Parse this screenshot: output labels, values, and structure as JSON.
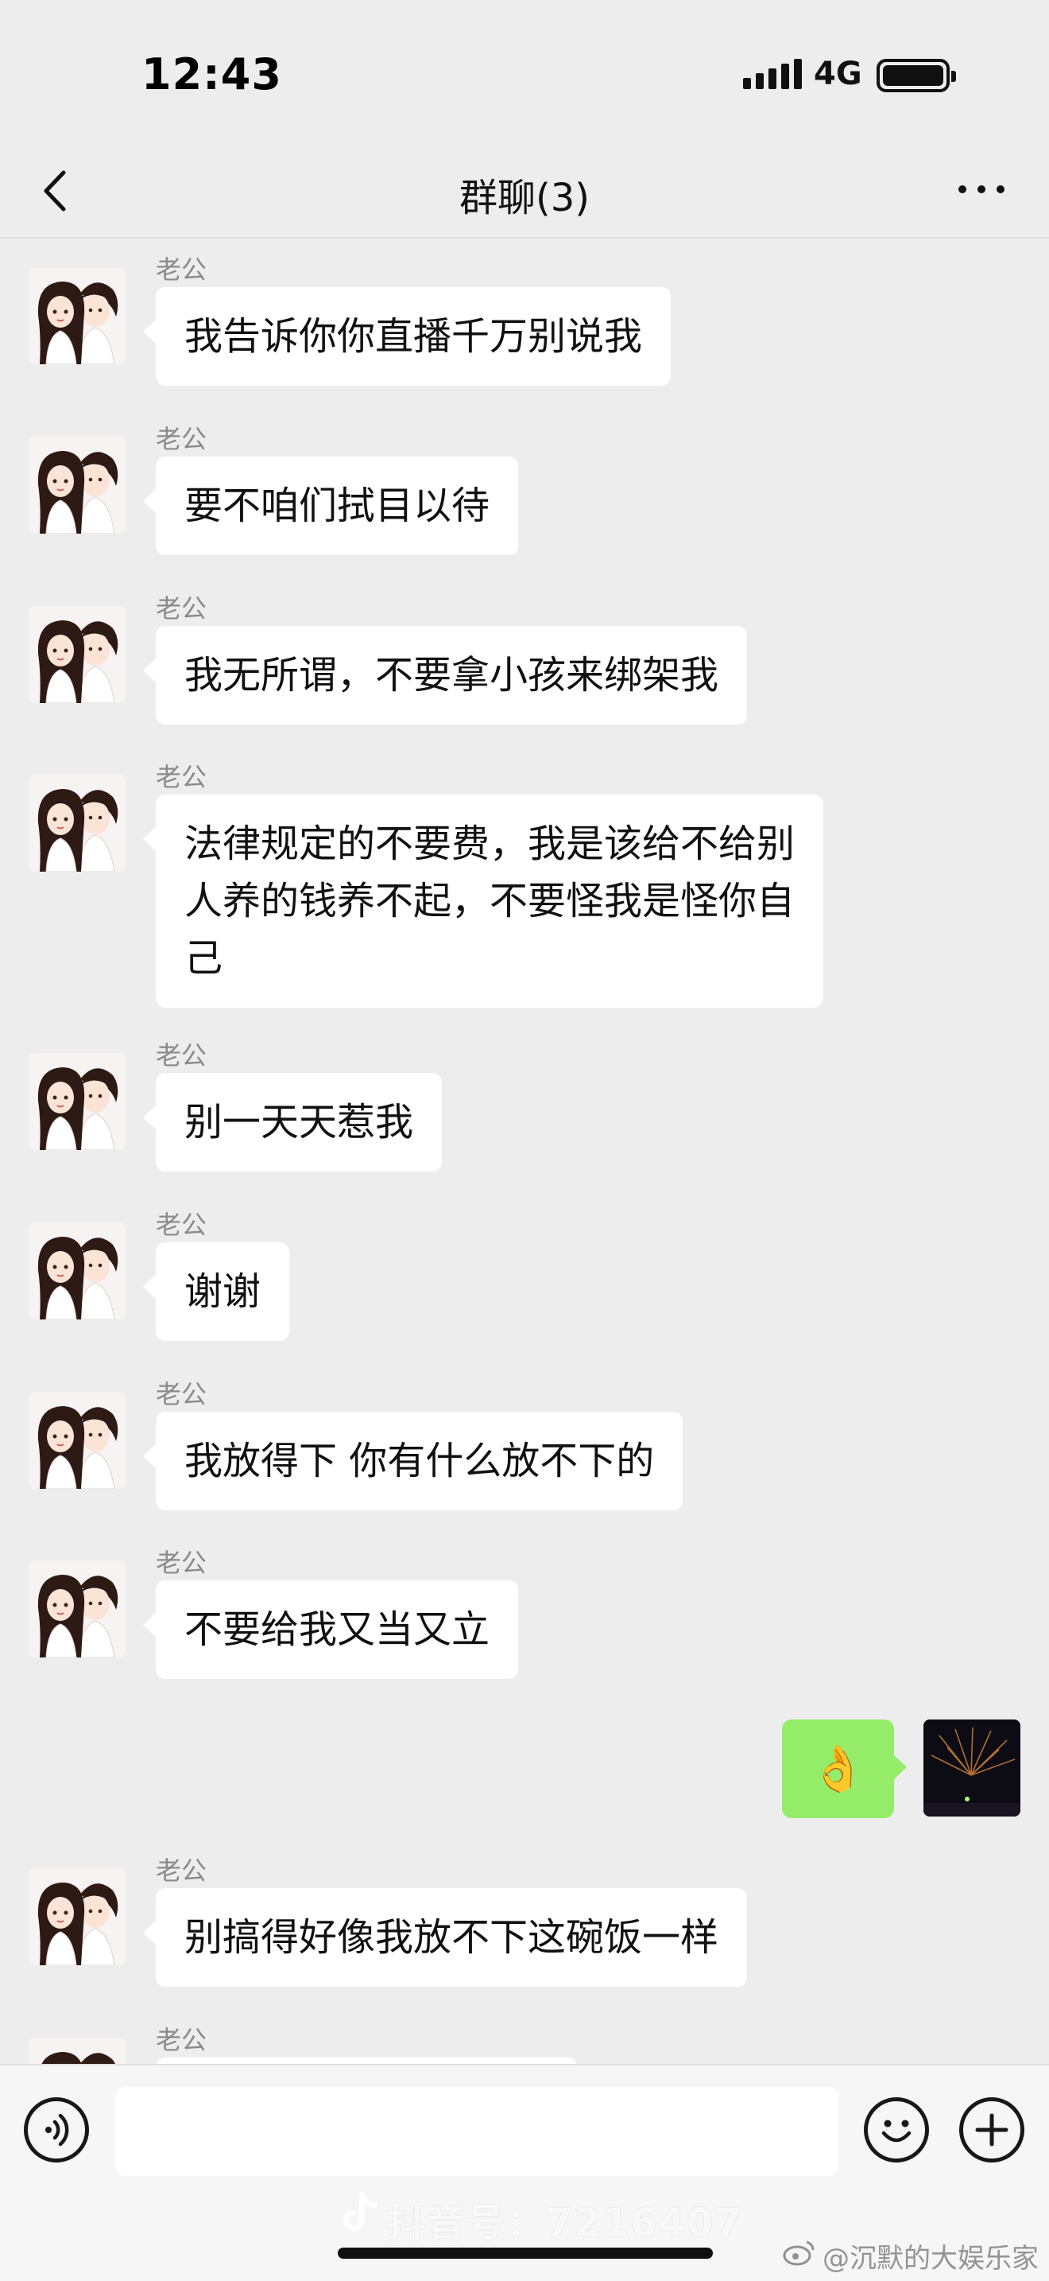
{
  "status_bar": {
    "time": "12:43",
    "network": "4G"
  },
  "nav": {
    "title": "群聊(3)"
  },
  "chat": {
    "messages": [
      {
        "sender": "老公",
        "text": "我告诉你你直播千万别说我"
      },
      {
        "sender": "老公",
        "text": "要不咱们拭目以待"
      },
      {
        "sender": "老公",
        "text": "我无所谓，不要拿小孩来绑架我"
      },
      {
        "sender": "老公",
        "text": "法律规定的不要费，我是该给不给别\n人养的钱养不起，不要怪我是怪你自\n己"
      },
      {
        "sender": "老公",
        "text": "别一天天惹我"
      },
      {
        "sender": "老公",
        "text": "谢谢"
      },
      {
        "sender": "老公",
        "text": "我放得下 你有什么放不下的"
      },
      {
        "sender": "老公",
        "text": "不要给我又当又立"
      },
      {
        "sender": "",
        "text": "👌"
      },
      {
        "sender": "老公",
        "text": "别搞得好像我放不下这碗饭一样"
      },
      {
        "sender": "老公",
        "text": ""
      }
    ]
  },
  "input": {
    "placeholder": ""
  },
  "watermarks": {
    "douyin": "抖音号：7216407",
    "weibo": "@沉默的大娱乐家"
  },
  "colors": {
    "background": "#ededed",
    "bubble_other": "#ffffff",
    "bubble_mine": "#95ec69"
  },
  "icons": {
    "back": "chevron-left-icon",
    "more": "more-dots-icon",
    "voice": "voice-icon",
    "emoji": "emoji-icon",
    "plus": "plus-icon",
    "douyin": "douyin-logo-icon",
    "weibo": "weibo-logo-icon"
  }
}
